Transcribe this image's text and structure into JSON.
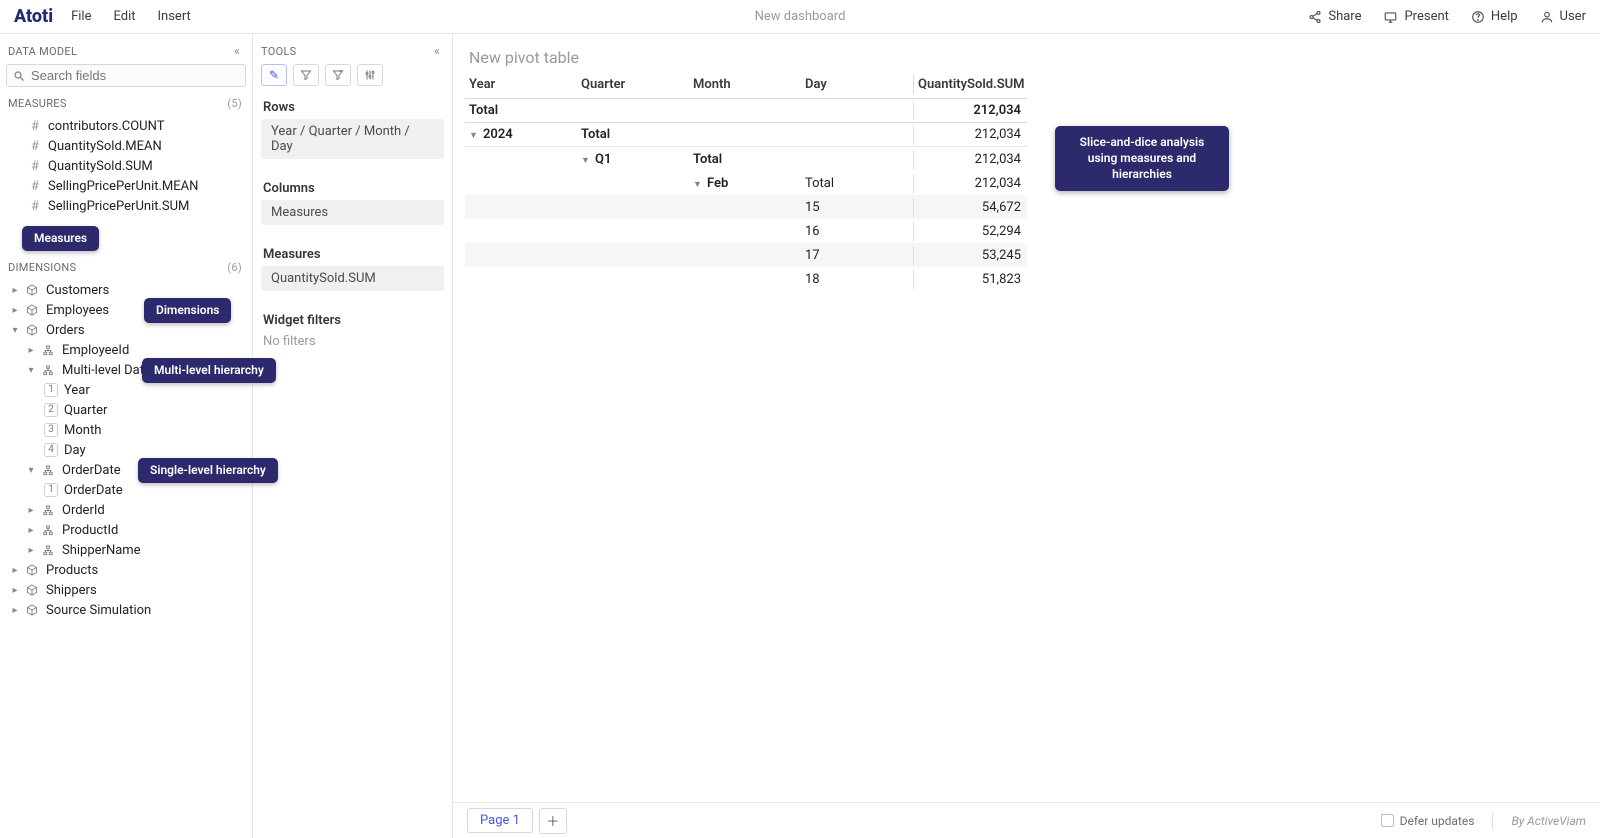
{
  "topbar": {
    "brand": "Atoti",
    "menu": [
      "File",
      "Edit",
      "Insert"
    ],
    "title": "New dashboard",
    "right": {
      "share": "Share",
      "present": "Present",
      "help": "Help",
      "user": "User"
    }
  },
  "dataModel": {
    "header": "Data Model",
    "searchPlaceholder": "Search fields",
    "measuresHeader": "Measures",
    "measuresCount": "(5)",
    "measures": [
      "contributors.COUNT",
      "QuantitySold.MEAN",
      "QuantitySold.SUM",
      "SellingPricePerUnit.MEAN",
      "SellingPricePerUnit.SUM"
    ],
    "dimensionsHeader": "Dimensions",
    "dimensionsCount": "(6)",
    "dimensions": {
      "customers": "Customers",
      "employees": "Employees",
      "orders": "Orders",
      "ordersChildren": {
        "employeeId": "EmployeeId",
        "multilevel": "Multi-level Date",
        "levels": {
          "1": "Year",
          "2": "Quarter",
          "3": "Month",
          "4": "Day"
        },
        "orderDate": "OrderDate",
        "orderDateChild": "OrderDate",
        "orderId": "OrderId",
        "productId": "ProductId",
        "shipperName": "ShipperName"
      },
      "products": "Products",
      "shippers": "Shippers",
      "sourceSim": "Source Simulation"
    }
  },
  "annotations": {
    "measures": "Measures",
    "dimensions": "Dimensions",
    "multi": "Multi-level hierarchy",
    "single": "Single-level hierarchy",
    "pivot": "Slice-and-dice analysis using measures and hierarchies"
  },
  "tools": {
    "header": "Tools",
    "rowsLabel": "Rows",
    "rowsValue": "Year / Quarter / Month / Day",
    "columnsLabel": "Columns",
    "columnsValue": "Measures",
    "measuresLabel": "Measures",
    "measuresValue": "QuantitySold.SUM",
    "filtersLabel": "Widget filters",
    "filtersEmpty": "No filters"
  },
  "pivot": {
    "title": "New pivot table",
    "headers": {
      "year": "Year",
      "quarter": "Quarter",
      "month": "Month",
      "day": "Day",
      "measure": "QuantitySold.SUM"
    },
    "labels": {
      "total": "Total",
      "year": "2024",
      "q": "Q1",
      "month": "Feb"
    },
    "values": {
      "grand": "212,034",
      "year": "212,034",
      "quarter": "212,034",
      "month": "212,034",
      "d15": "54,672",
      "d16": "52,294",
      "d17": "53,245",
      "d18": "51,823"
    },
    "days": {
      "d15": "15",
      "d16": "16",
      "d17": "17",
      "d18": "18"
    }
  },
  "footer": {
    "page": "Page 1",
    "defer": "Defer updates",
    "byline": "By ActiveViam"
  }
}
